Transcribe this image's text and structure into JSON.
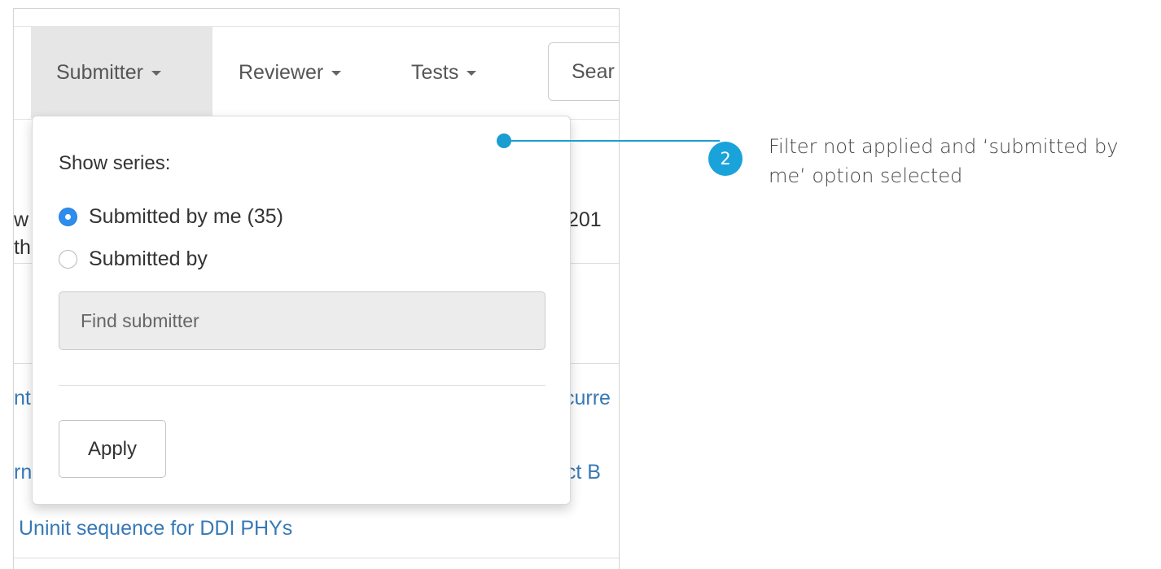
{
  "navbar": {
    "submitter_label": "Submitter",
    "reviewer_label": "Reviewer",
    "tests_label": "Tests",
    "search_fragment": "Sear"
  },
  "background": {
    "row1_text_a": "w",
    "row1_text_b": "th",
    "row1_date": "201",
    "row3_left": "nt",
    "row3_right": "curre",
    "row4_left": "rn",
    "row4_right": "uct B",
    "row5_link": "Uninit sequence for DDI PHYs"
  },
  "dropdown": {
    "title": "Show series:",
    "option_me": "Submitted by me (35)",
    "option_by": "Submitted by",
    "find_placeholder": "Find submitter",
    "apply_label": "Apply"
  },
  "callout": {
    "number": "2",
    "text": "Filter not applied and ‘submitted by me’ option selected"
  },
  "colors": {
    "accent": "#1aa3da",
    "radio_checked": "#2d8cf0",
    "link": "#3779b6",
    "active_nav": "#e6e6e6"
  }
}
